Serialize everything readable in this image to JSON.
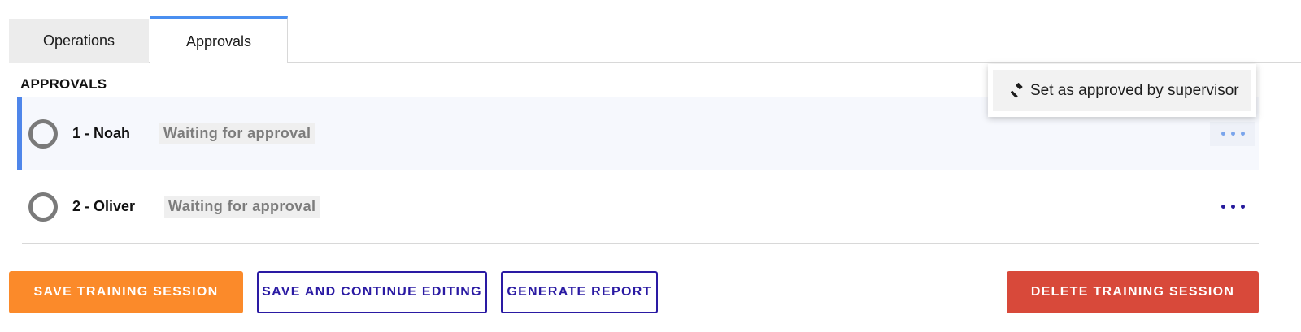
{
  "tabs": [
    {
      "label": "Operations",
      "active": false
    },
    {
      "label": "Approvals",
      "active": true
    }
  ],
  "section": {
    "heading": "APPROVALS"
  },
  "approvals": [
    {
      "name": "1 - Noah",
      "status": "Waiting for approval",
      "selected": true
    },
    {
      "name": "2 - Oliver",
      "status": "Waiting for approval",
      "selected": false
    }
  ],
  "menu": {
    "item_label": "Set as approved by supervisor",
    "item_icon": "gavel-icon"
  },
  "actions": {
    "save_label": "SAVE TRAINING SESSION",
    "continue_label": "SAVE AND CONTINUE EDITING",
    "report_label": "GENERATE REPORT",
    "delete_label": "DELETE TRAINING SESSION"
  },
  "colors": {
    "accent_blue": "#4a8ff0",
    "primary_orange": "#fb8a2a",
    "outline_navy": "#2a1aa3",
    "danger_red": "#d8493a"
  }
}
